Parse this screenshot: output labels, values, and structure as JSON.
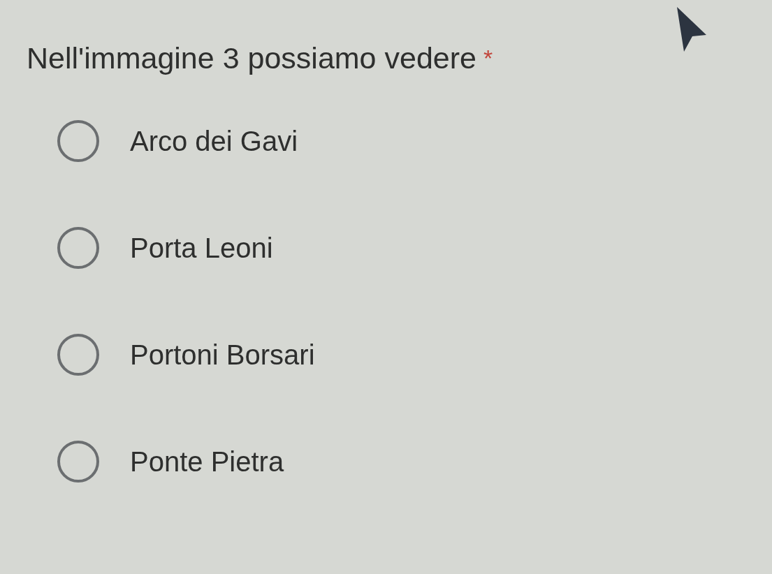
{
  "question": {
    "text": "Nell'immagine 3 possiamo vedere",
    "required": true,
    "required_mark": "*"
  },
  "options": [
    {
      "label": "Arco dei Gavi",
      "selected": false
    },
    {
      "label": "Porta Leoni",
      "selected": false
    },
    {
      "label": "Portoni Borsari",
      "selected": false
    },
    {
      "label": "Ponte Pietra",
      "selected": false
    }
  ]
}
